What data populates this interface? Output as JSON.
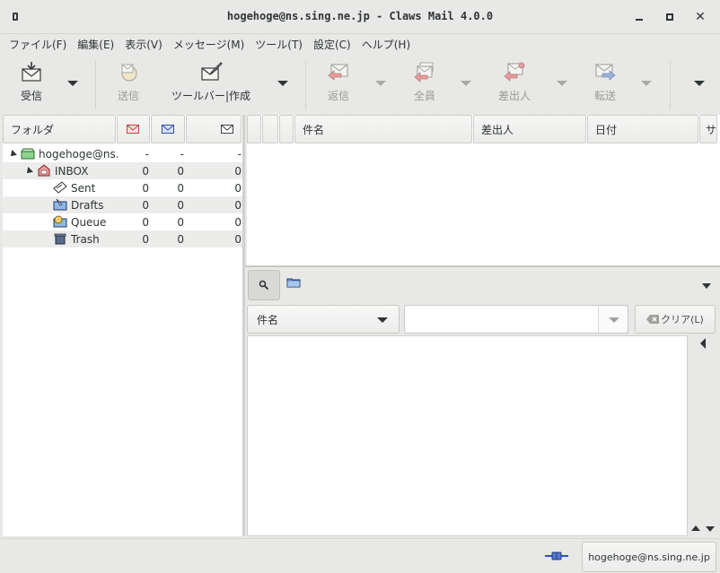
{
  "window": {
    "title": "hogehoge@ns.sing.ne.jp - Claws Mail 4.0.0",
    "minimize_label": "",
    "close_glyph": "✕"
  },
  "menubar": {
    "items": [
      {
        "label": "ファイル(F)"
      },
      {
        "label": "編集(E)"
      },
      {
        "label": "表示(V)"
      },
      {
        "label": "メッセージ(M)"
      },
      {
        "label": "ツール(T)"
      },
      {
        "label": "設定(C)"
      },
      {
        "label": "ヘルプ(H)"
      }
    ]
  },
  "toolbar": {
    "receive": {
      "label": "受信",
      "icon": "receive-mail-icon"
    },
    "send": {
      "label": "送信",
      "icon": "send-mail-icon"
    },
    "compose": {
      "label": "ツールバー|作成",
      "icon": "compose-icon"
    },
    "reply": {
      "label": "返信",
      "icon": "reply-icon"
    },
    "reply_all": {
      "label": "全員",
      "icon": "reply-all-icon"
    },
    "reply_sender": {
      "label": "差出人",
      "icon": "reply-sender-icon"
    },
    "forward": {
      "label": "転送",
      "icon": "forward-icon"
    }
  },
  "folder_view": {
    "header": {
      "folder": "フォルダ",
      "new_icon": "new-mail-icon",
      "unread_icon": "unread-mail-icon",
      "total_icon": "total-mail-icon"
    },
    "rows": [
      {
        "name": "hogehoge@ns.s",
        "new": "-",
        "unread": "-",
        "total": "-",
        "icon": "mailbox-icon"
      },
      {
        "name": "INBOX",
        "new": "0",
        "unread": "0",
        "total": "0",
        "icon": "inbox-icon"
      },
      {
        "name": "Sent",
        "new": "0",
        "unread": "0",
        "total": "0",
        "icon": "sent-icon"
      },
      {
        "name": "Drafts",
        "new": "0",
        "unread": "0",
        "total": "0",
        "icon": "drafts-icon"
      },
      {
        "name": "Queue",
        "new": "0",
        "unread": "0",
        "total": "0",
        "icon": "queue-icon"
      },
      {
        "name": "Trash",
        "new": "0",
        "unread": "0",
        "total": "0",
        "icon": "trash-icon"
      }
    ]
  },
  "message_list": {
    "columns": {
      "subject": "件名",
      "from": "差出人",
      "date": "日付",
      "size_partial": "サ"
    }
  },
  "quicksearch": {
    "type_selected": "件名",
    "input_value": "",
    "clear_label": "クリア(L)",
    "search_icon": "search-icon"
  },
  "statusbar": {
    "account": "hogehoge@ns.sing.ne.jp",
    "online_icon": "online-plug-icon"
  },
  "colors": {
    "background": "#e8e8e7",
    "pane_bg": "#ffffff",
    "alt_row": "#ececeb",
    "disabled_text": "#9a9c98"
  }
}
